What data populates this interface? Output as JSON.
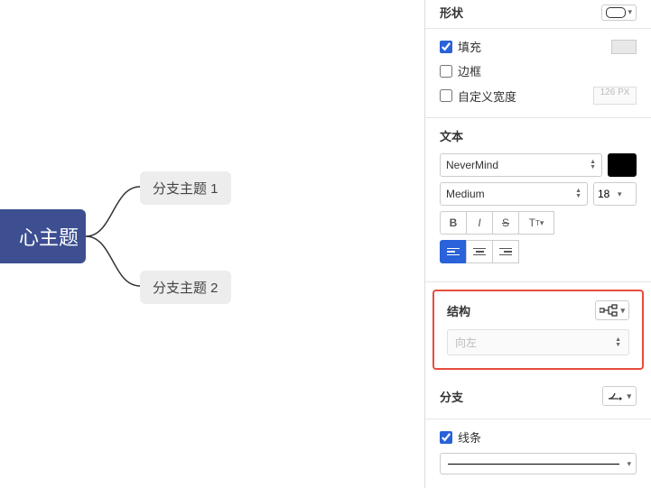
{
  "canvas": {
    "central": "心主题",
    "branch1": "分支主题 1",
    "branch2": "分支主题 2"
  },
  "shape": {
    "label": "形状"
  },
  "fill": {
    "label": "填充",
    "checked": true,
    "color": "#e8e8e8"
  },
  "border": {
    "label": "边框",
    "checked": false
  },
  "customWidth": {
    "label": "自定义宽度",
    "checked": false,
    "value": "126",
    "unit": "PX"
  },
  "text": {
    "label": "文本",
    "fontFamily": "NeverMind",
    "fontWeight": "Medium",
    "fontSize": "18",
    "color": "#000000"
  },
  "structure": {
    "label": "结构",
    "direction": "向左"
  },
  "branch": {
    "label": "分支"
  },
  "line": {
    "label": "线条",
    "checked": true
  }
}
